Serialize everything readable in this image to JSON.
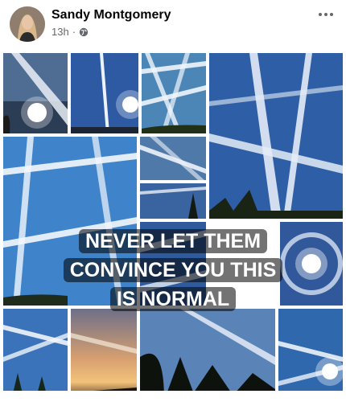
{
  "post": {
    "author_name": "Sandy Montgomery",
    "timestamp": "13h",
    "separator": "·",
    "audience_icon": "globe-icon",
    "more_icon": "more-options-icon"
  },
  "image": {
    "caption_lines": [
      "NEVER LET THEM",
      "CONVINCE YOU THIS",
      "IS NORMAL"
    ],
    "tile_themes": [
      "sky-with-sun",
      "sky-with-trails",
      "sun-halo",
      "sunset-sky",
      "silhouette-trees"
    ]
  },
  "colors": {
    "sky_blue": "#3d6fb6",
    "deep_sky": "#1f4a8e",
    "trail_white": "#eef3fb",
    "text_dark": "#050505",
    "meta_gray": "#65676b"
  }
}
